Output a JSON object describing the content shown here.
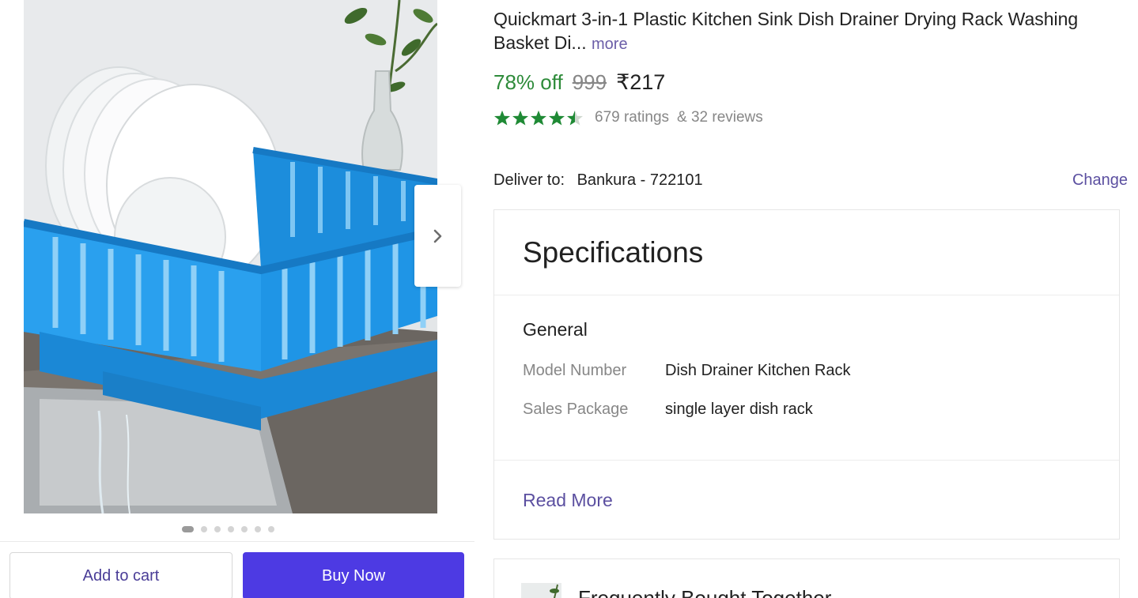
{
  "gallery": {
    "image_alt": "Quickmart dish drainer rack",
    "dots_total": 7,
    "active_dot": 0
  },
  "actions": {
    "add_to_cart": "Add to cart",
    "buy_now": "Buy Now"
  },
  "product": {
    "title": "Quickmart 3-in-1 Plastic Kitchen Sink Dish Drainer Drying Rack Washing Basket Di...",
    "more_link": "more",
    "discount": "78% off",
    "mrp": "999",
    "price": "₹217",
    "rating_stars": 4.5,
    "ratings_text": "679 ratings",
    "reviews_text": "& 32 reviews"
  },
  "delivery": {
    "label": "Deliver to:",
    "location": "Bankura - 722101",
    "change": "Change"
  },
  "specifications": {
    "title": "Specifications",
    "group": "General",
    "rows": [
      {
        "key": "Model Number",
        "value": "Dish Drainer Kitchen Rack"
      },
      {
        "key": "Sales Package",
        "value": "single layer dish rack"
      }
    ],
    "read_more": "Read More"
  },
  "frequently_bought": {
    "title": "Frequently Bought Together"
  },
  "colors": {
    "accent": "#4d3ae3",
    "link": "#5b4fa0",
    "discount_green": "#2e8b3a",
    "star_green": "#1f8a35"
  }
}
